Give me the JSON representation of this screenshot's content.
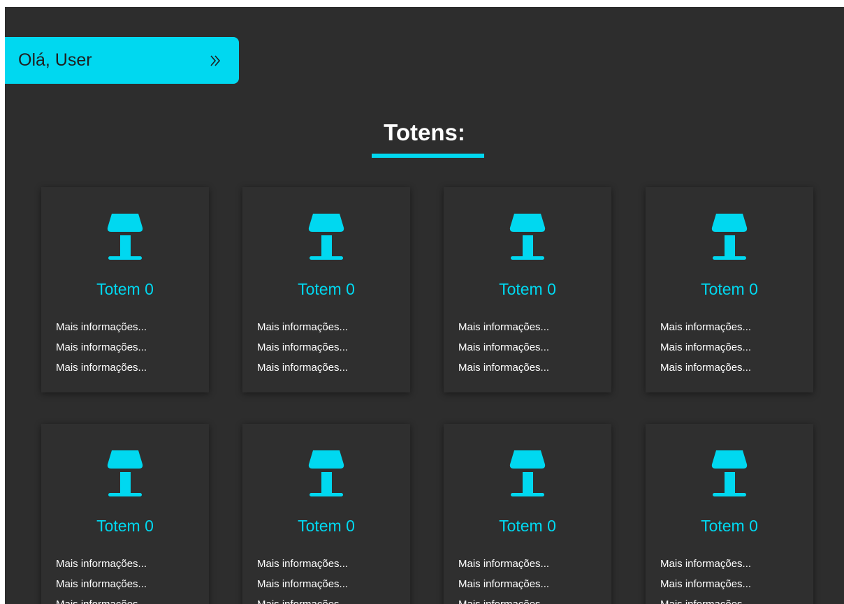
{
  "header": {
    "greeting": "Olá, User",
    "expand_icon": "double-chevron-right-icon"
  },
  "page": {
    "title": "Totens:"
  },
  "colors": {
    "accent": "#00d8f0",
    "background": "#2d2d2d",
    "card": "#2f2f2f",
    "text": "#ffffff"
  },
  "totems": [
    {
      "icon": "totem-lamp-icon",
      "name": "Totem 0",
      "info": [
        "Mais informações...",
        "Mais informações...",
        "Mais informações..."
      ]
    },
    {
      "icon": "totem-lamp-icon",
      "name": "Totem 0",
      "info": [
        "Mais informações...",
        "Mais informações...",
        "Mais informações..."
      ]
    },
    {
      "icon": "totem-lamp-icon",
      "name": "Totem 0",
      "info": [
        "Mais informações...",
        "Mais informações...",
        "Mais informações..."
      ]
    },
    {
      "icon": "totem-lamp-icon",
      "name": "Totem 0",
      "info": [
        "Mais informações...",
        "Mais informações...",
        "Mais informações..."
      ]
    },
    {
      "icon": "totem-lamp-icon",
      "name": "Totem 0",
      "info": [
        "Mais informações...",
        "Mais informações...",
        "Mais informações..."
      ]
    },
    {
      "icon": "totem-lamp-icon",
      "name": "Totem 0",
      "info": [
        "Mais informações...",
        "Mais informações...",
        "Mais informações..."
      ]
    },
    {
      "icon": "totem-lamp-icon",
      "name": "Totem 0",
      "info": [
        "Mais informações...",
        "Mais informações...",
        "Mais informações..."
      ]
    },
    {
      "icon": "totem-lamp-icon",
      "name": "Totem 0",
      "info": [
        "Mais informações...",
        "Mais informações...",
        "Mais informações..."
      ]
    }
  ]
}
